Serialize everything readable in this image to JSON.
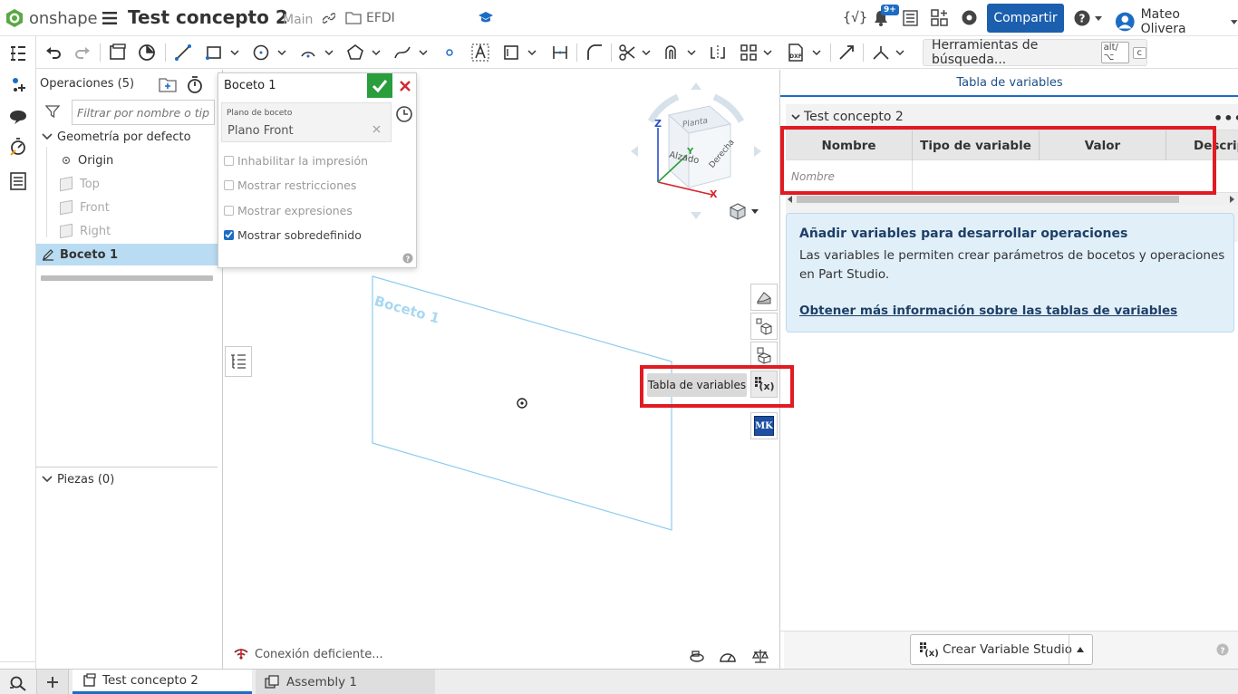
{
  "app": {
    "brand": "onshape",
    "doc_title": "Test concepto 2",
    "workspace": "Main",
    "folder": "EFDI"
  },
  "header": {
    "share_label": "Compartir",
    "notif_badge": "9+",
    "user_name": "Mateo Olivera"
  },
  "toolbar": {
    "search_tools_label": "Herramientas de búsqueda...",
    "shortcut_key1": "alt/⌥",
    "shortcut_key2": "c"
  },
  "features": {
    "title": "Operaciones (5)",
    "filter_placeholder": "Filtrar por nombre o tip",
    "default_geometry": "Geometría por defecto",
    "items": [
      "Origin",
      "Top",
      "Front",
      "Right"
    ],
    "sketch_item": "Boceto 1",
    "parts": "Piezas (0)"
  },
  "sketch_dialog": {
    "title": "Boceto 1",
    "plane_label": "Plano de boceto",
    "plane_value": "Plano Front",
    "options": [
      {
        "label": "Inhabilitar la impresión",
        "checked": false
      },
      {
        "label": "Mostrar restricciones",
        "checked": false
      },
      {
        "label": "Mostrar expresiones",
        "checked": false
      },
      {
        "label": "Mostrar sobredefinido",
        "checked": true
      }
    ]
  },
  "viewport": {
    "sketch_label": "Boceto 1",
    "cube": {
      "top": "Planta",
      "front": "Alzado",
      "right": "Derecha",
      "axis_x": "X",
      "axis_y": "Y",
      "axis_z": "Z"
    },
    "tooltip": "Tabla de variables",
    "mk_label": "MK",
    "connection": "Conexión deficiente..."
  },
  "variable_table": {
    "panel_title": "Tabla de variables",
    "section_title": "Test concepto 2",
    "columns": [
      "Nombre",
      "Tipo de variable",
      "Valor",
      "Descrip"
    ],
    "name_placeholder": "Nombre",
    "info_title": "Añadir variables para desarrollar operaciones",
    "info_text": "Las variables le permiten crear parámetros de bocetos y operaciones en Part Studio.",
    "info_link": "Obtener más información sobre las tablas de variables",
    "create_button": "Crear Variable Studio"
  },
  "tabs": [
    {
      "label": "Test concepto 2",
      "active": true
    },
    {
      "label": "Assembly 1",
      "active": false
    }
  ],
  "colors": {
    "accent": "#1d6cc4",
    "share_button": "#1b5fae",
    "confirm": "#2a9d3c",
    "cancel": "#d0282e",
    "highlight_box": "#e11b22",
    "sketch_plane": "#8ccdef"
  }
}
